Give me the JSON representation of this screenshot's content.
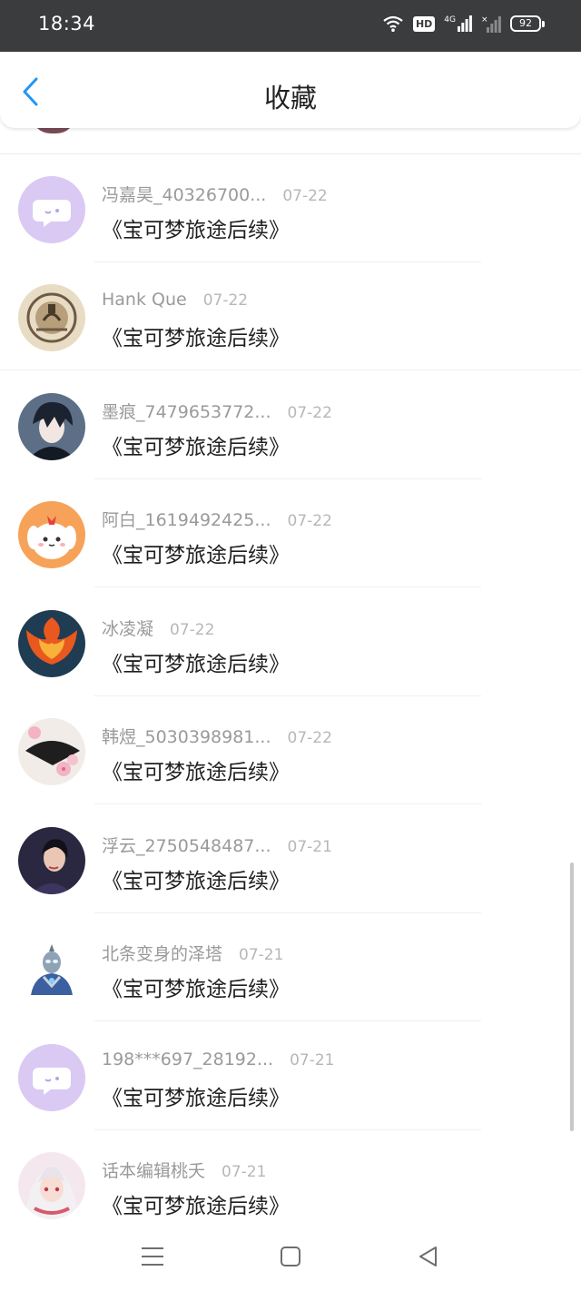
{
  "status_bar": {
    "time": "18:34",
    "hd_label": "HD",
    "network_label": "4G",
    "battery": "92"
  },
  "header": {
    "title": "收藏",
    "back_icon": "chevron-left-icon",
    "accent_color": "#2196f3"
  },
  "favorites": [
    {
      "user": "冯嘉昊_40326700...",
      "date": "07-22",
      "title": "《宝可梦旅途后续》",
      "avatar": "chat-bubble-avatar"
    },
    {
      "user": "Hank Que",
      "date": "07-22",
      "title": "《宝可梦旅途后续》",
      "avatar": "emblem-avatar"
    },
    {
      "user": "墨痕_7479653772...",
      "date": "07-22",
      "title": "《宝可梦旅途后续》",
      "avatar": "anime-boy-avatar"
    },
    {
      "user": "阿白_1619492425...",
      "date": "07-22",
      "title": "《宝可梦旅途后续》",
      "avatar": "cartoon-dog-avatar"
    },
    {
      "user": "冰凌凝",
      "date": "07-22",
      "title": "《宝可梦旅途后续》",
      "avatar": "phoenix-avatar"
    },
    {
      "user": "韩煜_5030398981...",
      "date": "07-22",
      "title": "《宝可梦旅途后续》",
      "avatar": "fan-flowers-avatar"
    },
    {
      "user": "浮云_2750548487...",
      "date": "07-21",
      "title": "《宝可梦旅途后续》",
      "avatar": "woman-portrait-avatar"
    },
    {
      "user": "北条变身的泽塔",
      "date": "07-21",
      "title": "《宝可梦旅途后续》",
      "avatar": "ultraman-avatar"
    },
    {
      "user": "198***697_28192...",
      "date": "07-21",
      "title": "《宝可梦旅途后续》",
      "avatar": "chat-bubble-avatar"
    },
    {
      "user": "话本编辑桃夭",
      "date": "07-21",
      "title": "《宝可梦旅途后续》",
      "avatar": "anime-girl-avatar"
    }
  ],
  "nav": {
    "menu_icon": "menu-icon",
    "home_icon": "home-square-icon",
    "back_icon": "back-triangle-icon"
  }
}
